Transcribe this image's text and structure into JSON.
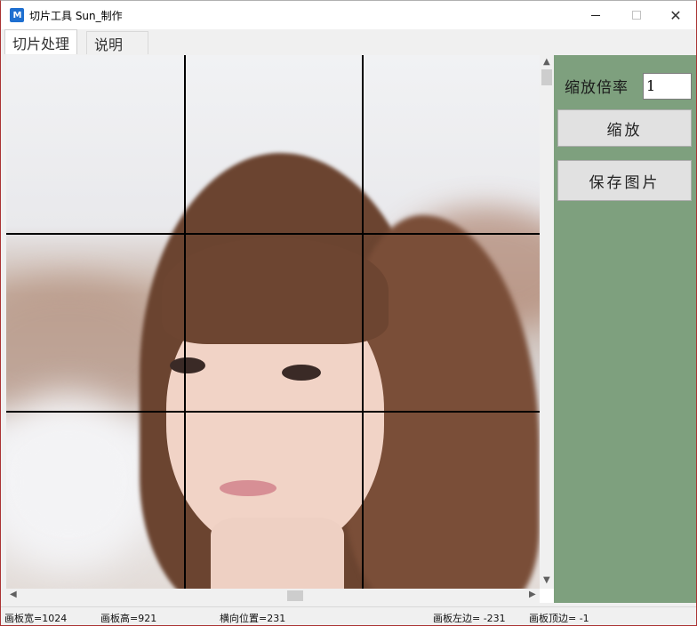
{
  "window": {
    "title": "切片工具  Sun_制作",
    "icon": "app-logo-icon",
    "icon_text": "M"
  },
  "tabs": [
    {
      "label": "切片处理",
      "active": true
    },
    {
      "label": "说明",
      "active": false
    }
  ],
  "panel": {
    "zoom_label": "缩放倍率",
    "zoom_value": "1",
    "zoom_button": "缩放",
    "save_button": "保存图片",
    "background": "#7ea07e"
  },
  "canvas": {
    "grid": "3x3",
    "grid_color": "#000000"
  },
  "status": {
    "canvas_width": "画板宽=1024",
    "canvas_height": "画板高=921",
    "h_position": "横向位置=231",
    "canvas_left": "画板左边= -231",
    "canvas_top": "画板顶边= -1"
  }
}
